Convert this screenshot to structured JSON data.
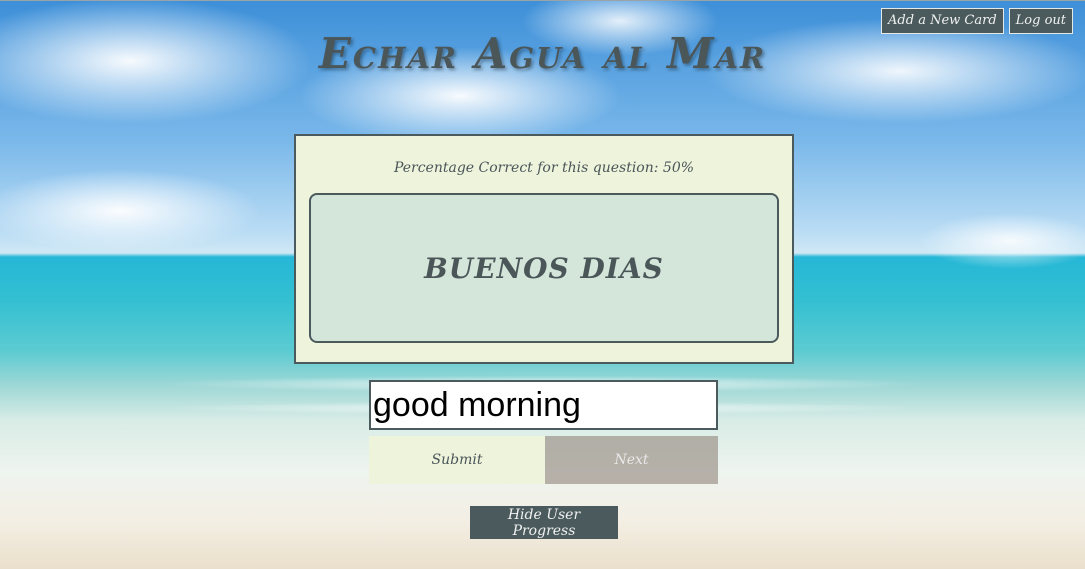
{
  "nav": {
    "add_card_label": "Add a New Card",
    "logout_label": "Log out"
  },
  "header": {
    "title": "Echar Agua al Mar"
  },
  "card": {
    "percentage_text": "Percentage Correct for this question: 50%",
    "question": "BUENOS DIAS"
  },
  "answer": {
    "value": "good morning"
  },
  "actions": {
    "submit_label": "Submit",
    "next_label": "Next",
    "progress_label": "Hide User Progress"
  },
  "colors": {
    "accent_dark": "#4b5b5d",
    "card_bg": "#eef3dc",
    "question_bg": "#d4e6da"
  }
}
